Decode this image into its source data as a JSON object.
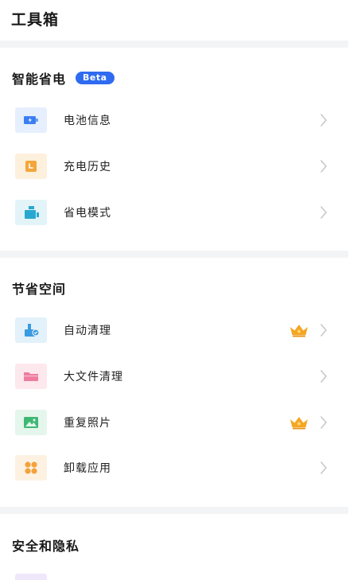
{
  "header": {
    "title": "工具箱"
  },
  "sections": [
    {
      "title": "智能省电",
      "badge": "Beta",
      "items": [
        {
          "label": "电池信息",
          "icon": "battery-icon",
          "tile_color": "#e6effd",
          "icon_color": "#3a7ef2",
          "premium": false
        },
        {
          "label": "充电历史",
          "icon": "charge-history-icon",
          "tile_color": "#fdf0dc",
          "icon_color": "#f4a63a",
          "premium": false
        },
        {
          "label": "省电模式",
          "icon": "power-saving-icon",
          "tile_color": "#e3f4f9",
          "icon_color": "#29a8cf",
          "premium": false
        }
      ]
    },
    {
      "title": "节省空间",
      "items": [
        {
          "label": "自动清理",
          "icon": "auto-clean-icon",
          "tile_color": "#e3f1fb",
          "icon_color": "#3a9be0",
          "premium": true
        },
        {
          "label": "大文件清理",
          "icon": "folder-icon",
          "tile_color": "#fde8ee",
          "icon_color": "#ef7c9e",
          "premium": false
        },
        {
          "label": "重复照片",
          "icon": "photo-icon",
          "tile_color": "#e5f6ec",
          "icon_color": "#3fb874",
          "premium": true
        },
        {
          "label": "卸载应用",
          "icon": "apps-grid-icon",
          "tile_color": "#fdf2e2",
          "icon_color": "#f2a23c",
          "premium": false
        }
      ]
    },
    {
      "title": "安全和隐私",
      "items": []
    }
  ],
  "colors": {
    "accent": "#2f6bf0",
    "crown": "#f5a623",
    "divider": "#f3f4f6",
    "chevron": "#c8c8c8"
  }
}
